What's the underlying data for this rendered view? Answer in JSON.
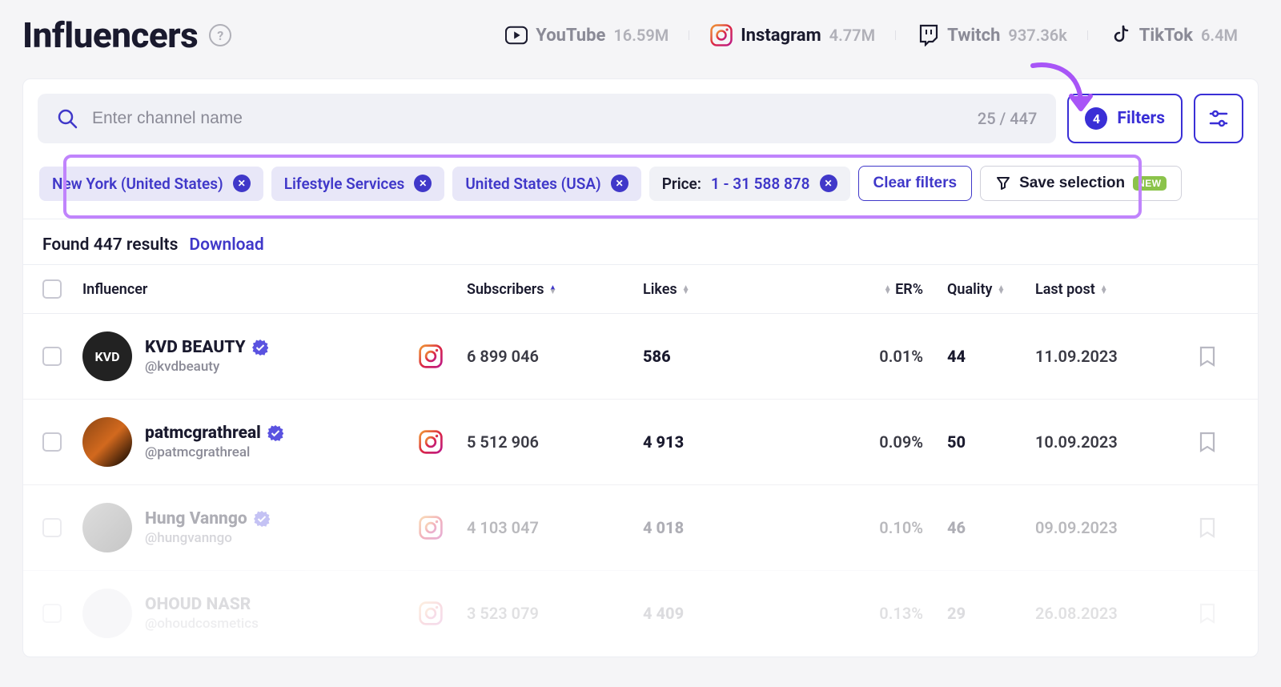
{
  "title": "Influencers",
  "platforms": [
    {
      "name": "YouTube",
      "count": "16.59M",
      "active": false
    },
    {
      "name": "Instagram",
      "count": "4.77M",
      "active": true
    },
    {
      "name": "Twitch",
      "count": "937.36k",
      "active": false
    },
    {
      "name": "TikTok",
      "count": "6.4M",
      "active": false
    }
  ],
  "search": {
    "placeholder": "Enter channel name",
    "count": "25 / 447"
  },
  "filters": {
    "badge": "4",
    "label": "Filters"
  },
  "chips": [
    {
      "label": "New York (United States)",
      "type": "loc"
    },
    {
      "label": "Lifestyle Services",
      "type": "cat"
    },
    {
      "label": "United States (USA)",
      "type": "country"
    }
  ],
  "priceChip": {
    "prefix": "Price:",
    "value": "1 - 31 588 878"
  },
  "clearFilters": "Clear filters",
  "saveSelection": "Save selection",
  "newBadge": "NEW",
  "results": {
    "text": "Found 447 results",
    "download": "Download"
  },
  "columns": {
    "influencer": "Influencer",
    "subscribers": "Subscribers",
    "likes": "Likes",
    "er": "ER%",
    "quality": "Quality",
    "lastPost": "Last post"
  },
  "rows": [
    {
      "name": "KVD BEAUTY",
      "handle": "@kvdbeauty",
      "subs": "6 899 046",
      "likes": "586",
      "er": "0.01%",
      "quality": "44",
      "last": "11.09.2023",
      "avatarTxt": "KVD",
      "faded": false
    },
    {
      "name": "patmcgrathreal",
      "handle": "@patmcgrathreal",
      "subs": "5 512 906",
      "likes": "4 913",
      "er": "0.09%",
      "quality": "50",
      "last": "10.09.2023",
      "avatarTxt": "",
      "faded": false
    },
    {
      "name": "Hung Vanngo",
      "handle": "@hungvanngo",
      "subs": "4 103 047",
      "likes": "4 018",
      "er": "0.10%",
      "quality": "46",
      "last": "09.09.2023",
      "avatarTxt": "",
      "faded": true
    },
    {
      "name": "OHOUD NASR",
      "handle": "@ohoudcosmetics",
      "subs": "3 523 079",
      "likes": "4 409",
      "er": "0.13%",
      "quality": "29",
      "last": "26.08.2023",
      "avatarTxt": "",
      "faded": true,
      "partial": true
    }
  ]
}
